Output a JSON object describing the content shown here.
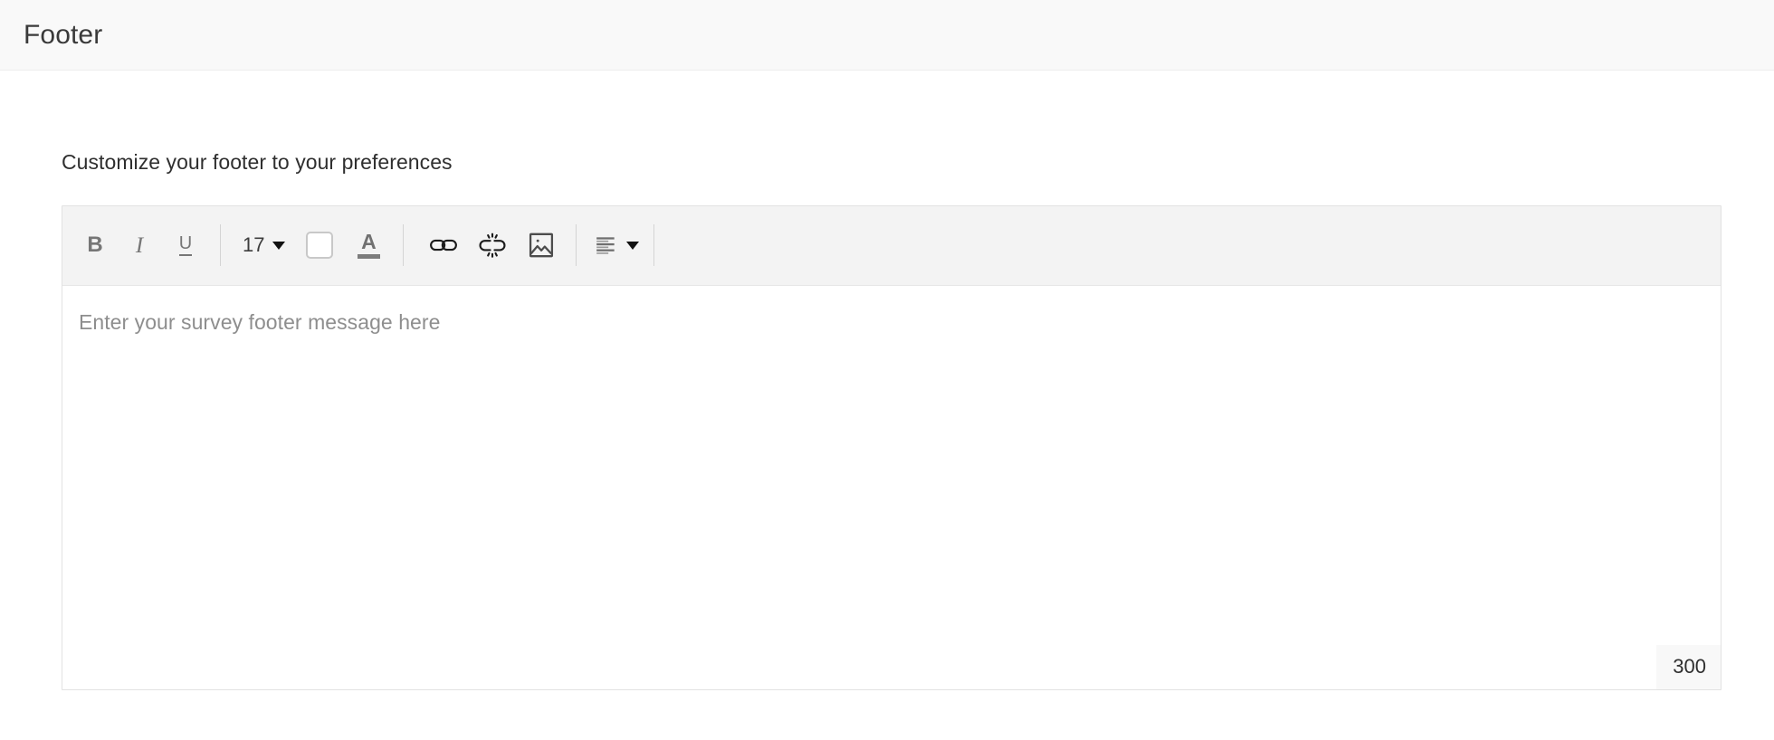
{
  "header": {
    "title": "Footer"
  },
  "main": {
    "section_title": "Customize your footer to your preferences"
  },
  "toolbar": {
    "bold_label": "B",
    "italic_label": "I",
    "underline_label": "U",
    "font_size_value": "17",
    "font_color_label": "A",
    "icons": {
      "bold": "bold-icon",
      "italic": "italic-icon",
      "underline": "underline-icon",
      "font_size": "font-size-dropdown",
      "background_color": "background-color-swatch",
      "font_color": "font-color-icon",
      "link": "link-icon",
      "unlink": "unlink-icon",
      "image": "image-icon",
      "align": "align-left-icon",
      "caret": "chevron-down-icon"
    },
    "colors": {
      "icon_gray": "#767676",
      "swatch_fill": "#ffffff",
      "swatch_border": "#c8c8c8",
      "caret_black": "#111111",
      "separator": "#d4d4d4",
      "toolbar_background": "#f3f3f3"
    }
  },
  "editor": {
    "placeholder": "Enter your survey footer message here",
    "value": "",
    "char_count": "300",
    "colors": {
      "border": "#e2e2e2",
      "counter_background": "#f8f8f8",
      "placeholder_text": "#8e8e8e"
    }
  },
  "page": {
    "header_background": "#f9f9f9",
    "body_background": "#ffffff",
    "title_color": "#3a3a3a"
  }
}
